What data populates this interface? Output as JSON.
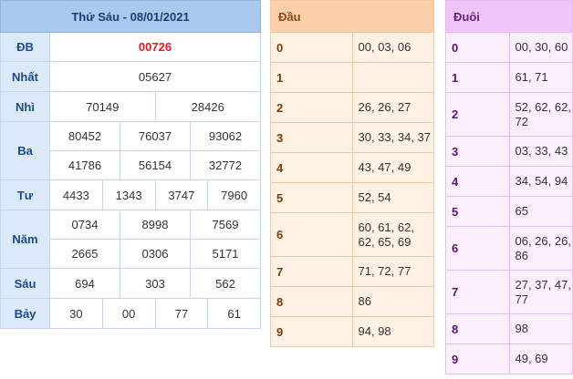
{
  "results": {
    "title": "Thứ Sáu - 08/01/2021",
    "rows": {
      "db": {
        "label": "ĐB",
        "values": [
          "00726"
        ]
      },
      "nhat": {
        "label": "Nhất",
        "values": [
          "05627"
        ]
      },
      "nhi": {
        "label": "Nhì",
        "values": [
          "70149",
          "28426"
        ]
      },
      "ba": {
        "label": "Ba",
        "values": [
          "80452",
          "76037",
          "93062",
          "41786",
          "56154",
          "32772"
        ]
      },
      "tu": {
        "label": "Tư",
        "values": [
          "4433",
          "1343",
          "3747",
          "7960"
        ]
      },
      "nam": {
        "label": "Năm",
        "values": [
          "0734",
          "8998",
          "7569",
          "2665",
          "0306",
          "5171"
        ]
      },
      "sau": {
        "label": "Sáu",
        "values": [
          "694",
          "303",
          "562"
        ]
      },
      "bay": {
        "label": "Bảy",
        "values": [
          "30",
          "00",
          "77",
          "61"
        ]
      }
    },
    "colors": {
      "special": "#e8141f",
      "header": "#a9c9ee",
      "label_bg": "#dce9f8"
    }
  },
  "dau": {
    "title": "Đầu",
    "rows": [
      {
        "digit": "0",
        "values": "00, 03, 06"
      },
      {
        "digit": "1",
        "values": ""
      },
      {
        "digit": "2",
        "values": "26, 26, 27"
      },
      {
        "digit": "3",
        "values": "30, 33, 34, 37"
      },
      {
        "digit": "4",
        "values": "43, 47, 49"
      },
      {
        "digit": "5",
        "values": "52, 54"
      },
      {
        "digit": "6",
        "values": "60, 61, 62, 62, 65, 69"
      },
      {
        "digit": "7",
        "values": "71, 72, 77"
      },
      {
        "digit": "8",
        "values": "86"
      },
      {
        "digit": "9",
        "values": "94, 98"
      }
    ]
  },
  "duoi": {
    "title": "Đuôi",
    "rows": [
      {
        "digit": "0",
        "values": "00, 30, 60"
      },
      {
        "digit": "1",
        "values": "61, 71"
      },
      {
        "digit": "2",
        "values": "52, 62, 62, 72"
      },
      {
        "digit": "3",
        "values": "03, 33, 43"
      },
      {
        "digit": "4",
        "values": "34, 54, 94"
      },
      {
        "digit": "5",
        "values": "65"
      },
      {
        "digit": "6",
        "values": "06, 26, 26, 86"
      },
      {
        "digit": "7",
        "values": "27, 37, 47, 77"
      },
      {
        "digit": "8",
        "values": "98"
      },
      {
        "digit": "9",
        "values": "49, 69"
      }
    ]
  }
}
